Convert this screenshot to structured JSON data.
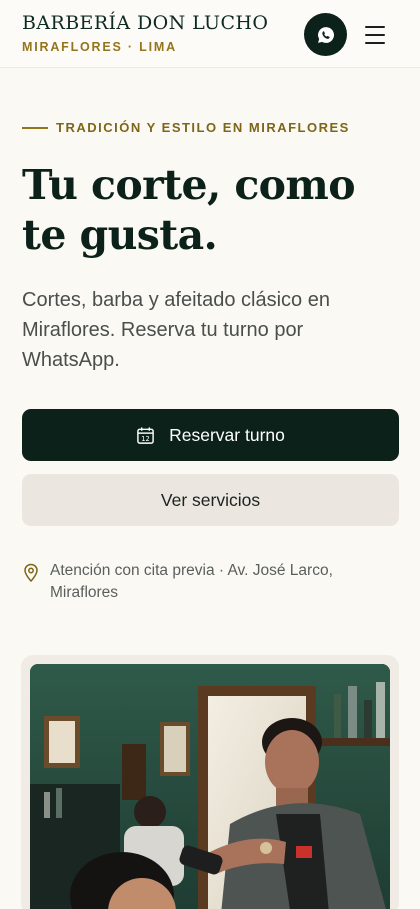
{
  "header": {
    "brand_name": "BARBERÍA DON LUCHO",
    "brand_location": "MIRAFLORES · LIMA",
    "whatsapp_icon": "whatsapp-icon",
    "menu_icon": "hamburger-menu-icon"
  },
  "hero": {
    "eyebrow": "TRADICIÓN Y ESTILO EN MIRAFLORES",
    "headline": "Tu corte, como te gusta.",
    "subtitle": "Cortes, barba y afeitado clásico en Miraflores. Reserva tu turno por WhatsApp.",
    "primary_cta": "Reservar turno",
    "primary_cta_icon": "calendar-icon",
    "calendar_day": "12",
    "secondary_cta": "Ver servicios",
    "address_icon": "map-pin-icon",
    "address": "Atención con cita previa · Av. José Larco, Miraflores"
  },
  "colors": {
    "background": "#fbf9f4",
    "primary": "#0b2119",
    "accent_gold": "#93751d",
    "secondary_button": "#ebe7e0"
  }
}
